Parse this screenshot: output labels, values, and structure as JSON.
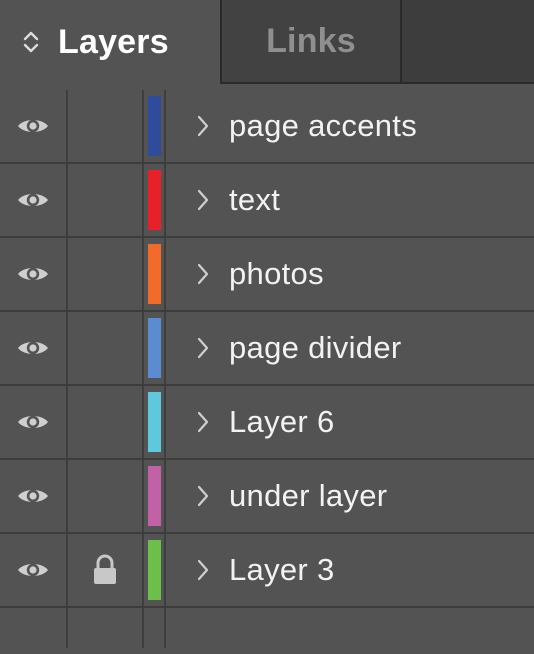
{
  "tabs": [
    {
      "label": "Layers",
      "active": true
    },
    {
      "label": "Links",
      "active": false
    }
  ],
  "layers": [
    {
      "name": "page accents",
      "color": "#2f4b9c",
      "visible": true,
      "locked": false
    },
    {
      "name": "text",
      "color": "#e8202a",
      "visible": true,
      "locked": false
    },
    {
      "name": "photos",
      "color": "#f26b2a",
      "visible": true,
      "locked": false
    },
    {
      "name": "page divider",
      "color": "#5b8bd0",
      "visible": true,
      "locked": false
    },
    {
      "name": "Layer 6",
      "color": "#5fc8dc",
      "visible": true,
      "locked": false
    },
    {
      "name": "under layer",
      "color": "#c261a6",
      "visible": true,
      "locked": false
    },
    {
      "name": "Layer 3",
      "color": "#6cc04a",
      "visible": true,
      "locked": true
    }
  ],
  "icons": {
    "sort": "sort-updown-icon",
    "visibility": "eye-icon",
    "lock": "lock-icon",
    "expand": "chevron-right-icon"
  }
}
